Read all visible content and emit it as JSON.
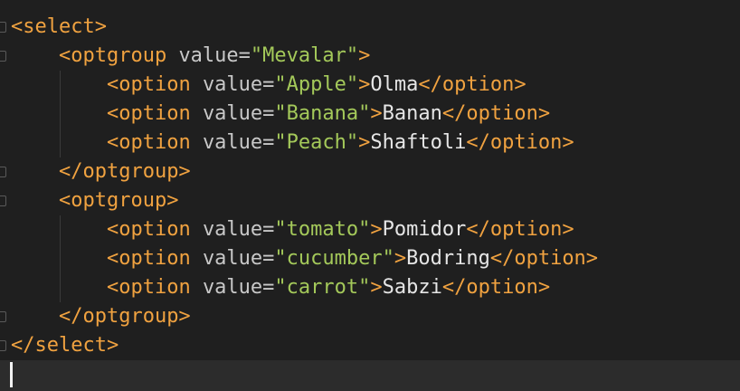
{
  "lines": [
    {
      "parts": [
        {
          "t": "tag",
          "v": "<select>"
        }
      ]
    },
    {
      "indent": "    ",
      "parts": [
        {
          "t": "tag",
          "v": "<optgroup "
        },
        {
          "t": "attr",
          "v": "value="
        },
        {
          "t": "str",
          "v": "\"Mevalar\""
        },
        {
          "t": "tag",
          "v": ">"
        }
      ]
    },
    {
      "indent": "        ",
      "parts": [
        {
          "t": "tag",
          "v": "<option "
        },
        {
          "t": "attr",
          "v": "value="
        },
        {
          "t": "str",
          "v": "\"Apple\""
        },
        {
          "t": "tag",
          "v": ">"
        },
        {
          "t": "txt",
          "v": "Olma"
        },
        {
          "t": "tag",
          "v": "</option>"
        }
      ]
    },
    {
      "indent": "        ",
      "parts": [
        {
          "t": "tag",
          "v": "<option "
        },
        {
          "t": "attr",
          "v": "value="
        },
        {
          "t": "str",
          "v": "\"Banana\""
        },
        {
          "t": "tag",
          "v": ">"
        },
        {
          "t": "txt",
          "v": "Banan"
        },
        {
          "t": "tag",
          "v": "</option>"
        }
      ]
    },
    {
      "indent": "        ",
      "parts": [
        {
          "t": "tag",
          "v": "<option "
        },
        {
          "t": "attr",
          "v": "value="
        },
        {
          "t": "str",
          "v": "\"Peach\""
        },
        {
          "t": "tag",
          "v": ">"
        },
        {
          "t": "txt",
          "v": "Shaftoli"
        },
        {
          "t": "tag",
          "v": "</option>"
        }
      ]
    },
    {
      "indent": "    ",
      "parts": [
        {
          "t": "tag",
          "v": "</optgroup>"
        }
      ]
    },
    {
      "indent": "    ",
      "parts": [
        {
          "t": "tag",
          "v": "<optgroup>"
        }
      ]
    },
    {
      "indent": "        ",
      "parts": [
        {
          "t": "tag",
          "v": "<option "
        },
        {
          "t": "attr",
          "v": "value="
        },
        {
          "t": "str",
          "v": "\"tomato\""
        },
        {
          "t": "tag",
          "v": ">"
        },
        {
          "t": "txt",
          "v": "Pomidor"
        },
        {
          "t": "tag",
          "v": "</option>"
        }
      ]
    },
    {
      "indent": "        ",
      "parts": [
        {
          "t": "tag",
          "v": "<option "
        },
        {
          "t": "attr",
          "v": "value="
        },
        {
          "t": "str",
          "v": "\"cucumber\""
        },
        {
          "t": "tag",
          "v": ">"
        },
        {
          "t": "txt",
          "v": "Bodring"
        },
        {
          "t": "tag",
          "v": "</option>"
        }
      ]
    },
    {
      "indent": "        ",
      "parts": [
        {
          "t": "tag",
          "v": "<option "
        },
        {
          "t": "attr",
          "v": "value="
        },
        {
          "t": "str",
          "v": "\"carrot\""
        },
        {
          "t": "tag",
          "v": ">"
        },
        {
          "t": "txt",
          "v": "Sabzi"
        },
        {
          "t": "tag",
          "v": "</option>"
        }
      ]
    },
    {
      "indent": "    ",
      "parts": [
        {
          "t": "tag",
          "v": "</optgroup>"
        }
      ]
    },
    {
      "parts": [
        {
          "t": "tag",
          "v": "</select>"
        }
      ]
    }
  ],
  "colors": {
    "tag": "#f0a240",
    "attr": "#c8c8c8",
    "string": "#a4c95a",
    "text": "#e6e6e6",
    "background": "#1f1f1f"
  }
}
